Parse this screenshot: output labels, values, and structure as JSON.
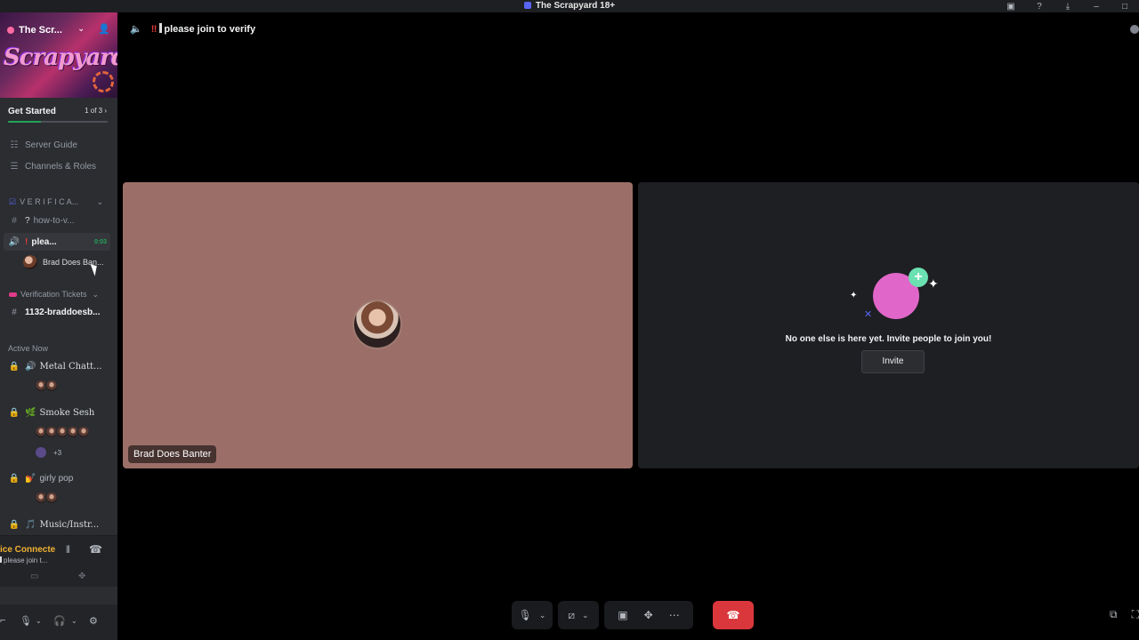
{
  "window": {
    "title": "The Scrapyard 18+"
  },
  "titlebar_icons": [
    "inbox-icon",
    "help-icon",
    "download-icon",
    "minimize-icon",
    "maximize-icon"
  ],
  "server": {
    "name": "The Scr...",
    "banner_text": "Scrapyard"
  },
  "get_started": {
    "label": "Get Started",
    "progress_text": "1 of 3",
    "progress_fraction": 0.33
  },
  "nav": {
    "server_guide": "Server Guide",
    "channels_roles": "Channels & Roles"
  },
  "verification_category": {
    "label": "V E R I F I C A...",
    "channels": [
      {
        "name": "how-to-v...",
        "type": "text",
        "prefix": "?"
      },
      {
        "name": "plea...",
        "type": "voice",
        "prefix": "!",
        "timer": "0:03",
        "active": true
      }
    ],
    "voice_user": "Brad Does Ban..."
  },
  "tickets_category": {
    "label": "Verification Tickets",
    "channels": [
      {
        "name": "1132-braddoesb...",
        "type": "text"
      }
    ]
  },
  "active_now": {
    "label": "Active Now",
    "channels": [
      {
        "name": "Metal Chatt...",
        "emoji": "🔊"
      },
      {
        "name": "Smoke Sesh",
        "emoji": "🌿",
        "more_count": "+3"
      },
      {
        "name": "girly pop",
        "emoji": "💅"
      },
      {
        "name": "Music/Instr...",
        "emoji": "🎵"
      }
    ]
  },
  "voice_status": {
    "title": "ice Connecte",
    "subtitle": "please join t..."
  },
  "main": {
    "channel_title": "please join to verify",
    "participant_name": "Brad Does Banter",
    "empty_message": "No one else is here yet. Invite people to join you!",
    "invite_label": "Invite"
  },
  "colors": {
    "accent": "#5865f2",
    "tile_bg": "#9b6f68",
    "end_call": "#da373c",
    "online": "#23a55a"
  }
}
